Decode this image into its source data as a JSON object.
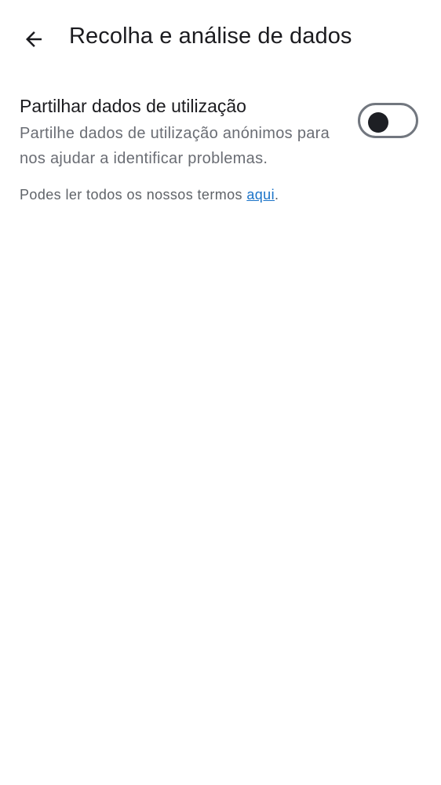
{
  "header": {
    "back_icon": "arrow-left-icon",
    "title": "Recolha e análise de dados"
  },
  "setting": {
    "title": "Partilhar dados de utilização",
    "description": "Partilhe dados de utilização anónimos para nos ajudar a identificar problemas.",
    "toggle_on": false
  },
  "terms": {
    "prefix": "Podes ler todos os nossos termos ",
    "link_text": "aqui",
    "suffix": "."
  },
  "colors": {
    "background": "#ffffff",
    "title_text": "#1b1b1f",
    "secondary_text": "#6a6d74",
    "link": "#1a73c8",
    "toggle_outline": "#72777f",
    "toggle_thumb": "#1d1f24"
  }
}
